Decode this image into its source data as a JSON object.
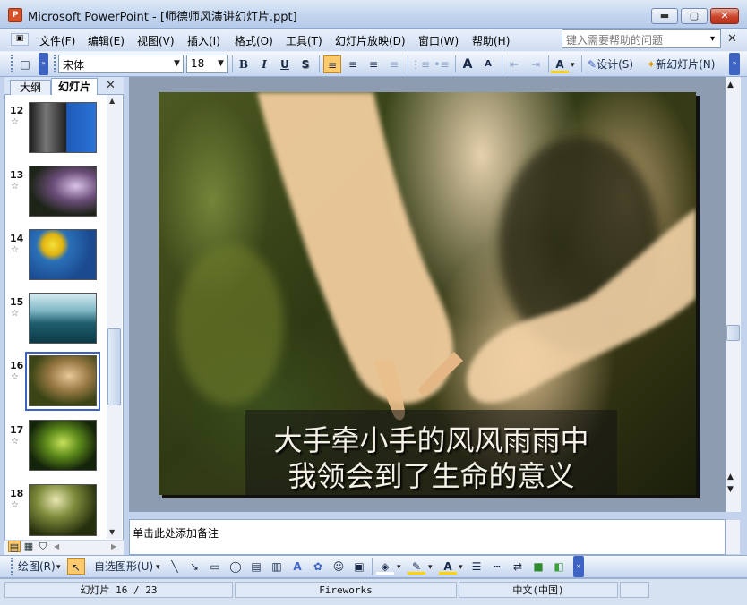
{
  "window": {
    "app_icon": "P",
    "title": "Microsoft PowerPoint - [师德师风演讲幻灯片.ppt]",
    "minimize": "▬",
    "maximize": "▢",
    "close": "✕"
  },
  "menu": {
    "items": [
      "文件(F)",
      "编辑(E)",
      "视图(V)",
      "插入(I)",
      "格式(O)",
      "工具(T)",
      "幻灯片放映(D)",
      "窗口(W)",
      "帮助(H)"
    ],
    "help_placeholder": "键入需要帮助的问题",
    "help_dropdown": "▾",
    "close": "✕"
  },
  "toolbar": {
    "new_icon": "□",
    "font_name": "宋体",
    "font_size": "18",
    "bold": "B",
    "italic": "I",
    "underline": "U",
    "shadow": "S",
    "align_left": "≡",
    "align_center": "≡",
    "align_right": "≡",
    "justify": "≡",
    "numbering": "⋮≡",
    "bullets": "•≡",
    "increase_font": "A",
    "decrease_font": "A",
    "decrease_indent": "⇤",
    "increase_indent": "⇥",
    "font_color": "A",
    "design": "设计(S)",
    "new_slide": "新幻灯片(N)",
    "accent_color": "#ffc96e"
  },
  "left_panel": {
    "tab_outline": "大纲",
    "tab_slides": "幻灯片",
    "close": "✕",
    "star": "☆",
    "slides": [
      {
        "num": "12"
      },
      {
        "num": "13"
      },
      {
        "num": "14"
      },
      {
        "num": "15"
      },
      {
        "num": "16",
        "selected": true
      },
      {
        "num": "17"
      },
      {
        "num": "18"
      }
    ],
    "scroll_up": "▲",
    "scroll_down": "▼"
  },
  "slide": {
    "caption_line1": "大手牵小手的风风雨雨中",
    "caption_line2": "我领会到了生命的意义"
  },
  "right_scroll": {
    "up": "▲",
    "prev_slide": "▲",
    "next_slide": "▼"
  },
  "notes": {
    "placeholder": "单击此处添加备注"
  },
  "drawing_toolbar": {
    "draw": "绘图(R)",
    "autoshapes": "自选图形(U)",
    "expand": "»"
  },
  "status": {
    "slide_position": "幻灯片 16 / 23",
    "design_name": "Fireworks",
    "language": "中文(中国)"
  }
}
